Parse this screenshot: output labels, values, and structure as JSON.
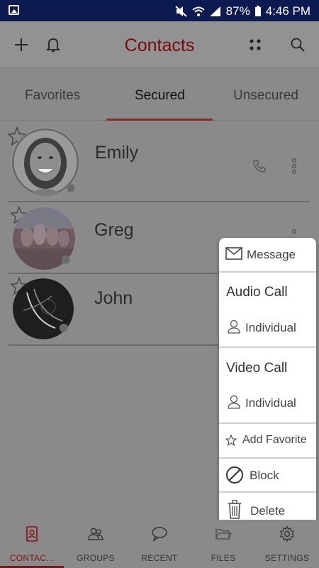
{
  "status_bar": {
    "battery": "87%",
    "time": "4:46 PM",
    "icons": [
      "gallery-icon",
      "mute-icon",
      "wifi-icon",
      "signal-icon"
    ]
  },
  "app_bar": {
    "title": "Contacts",
    "icons": [
      "plus-icon",
      "bell-icon",
      "grid-icon",
      "search-icon"
    ]
  },
  "tabs": {
    "items": [
      {
        "label": "Favorites"
      },
      {
        "label": "Secured"
      },
      {
        "label": "Unsecured"
      }
    ],
    "active": "Secured"
  },
  "contacts": [
    {
      "name": "Emily"
    },
    {
      "name": "Greg"
    },
    {
      "name": "John"
    }
  ],
  "menu": {
    "message": "Message",
    "audio_call": {
      "title": "Audio Call",
      "option": "Individual"
    },
    "video_call": {
      "title": "Video Call",
      "option": "Individual"
    },
    "add_favorite": "Add Favorite",
    "block": "Block",
    "delete": "Delete"
  },
  "bottom_nav": {
    "items": [
      {
        "label": "CONTAC..."
      },
      {
        "label": "GROUPS"
      },
      {
        "label": "RECENT"
      },
      {
        "label": "FILES"
      },
      {
        "label": "SETTINGS"
      }
    ],
    "active": "CONTAC..."
  },
  "colors": {
    "status_bar": "#0c1a52",
    "accent": "#a32020",
    "dim_background": "#8a8a8a",
    "menu_background": "#ffffff"
  }
}
